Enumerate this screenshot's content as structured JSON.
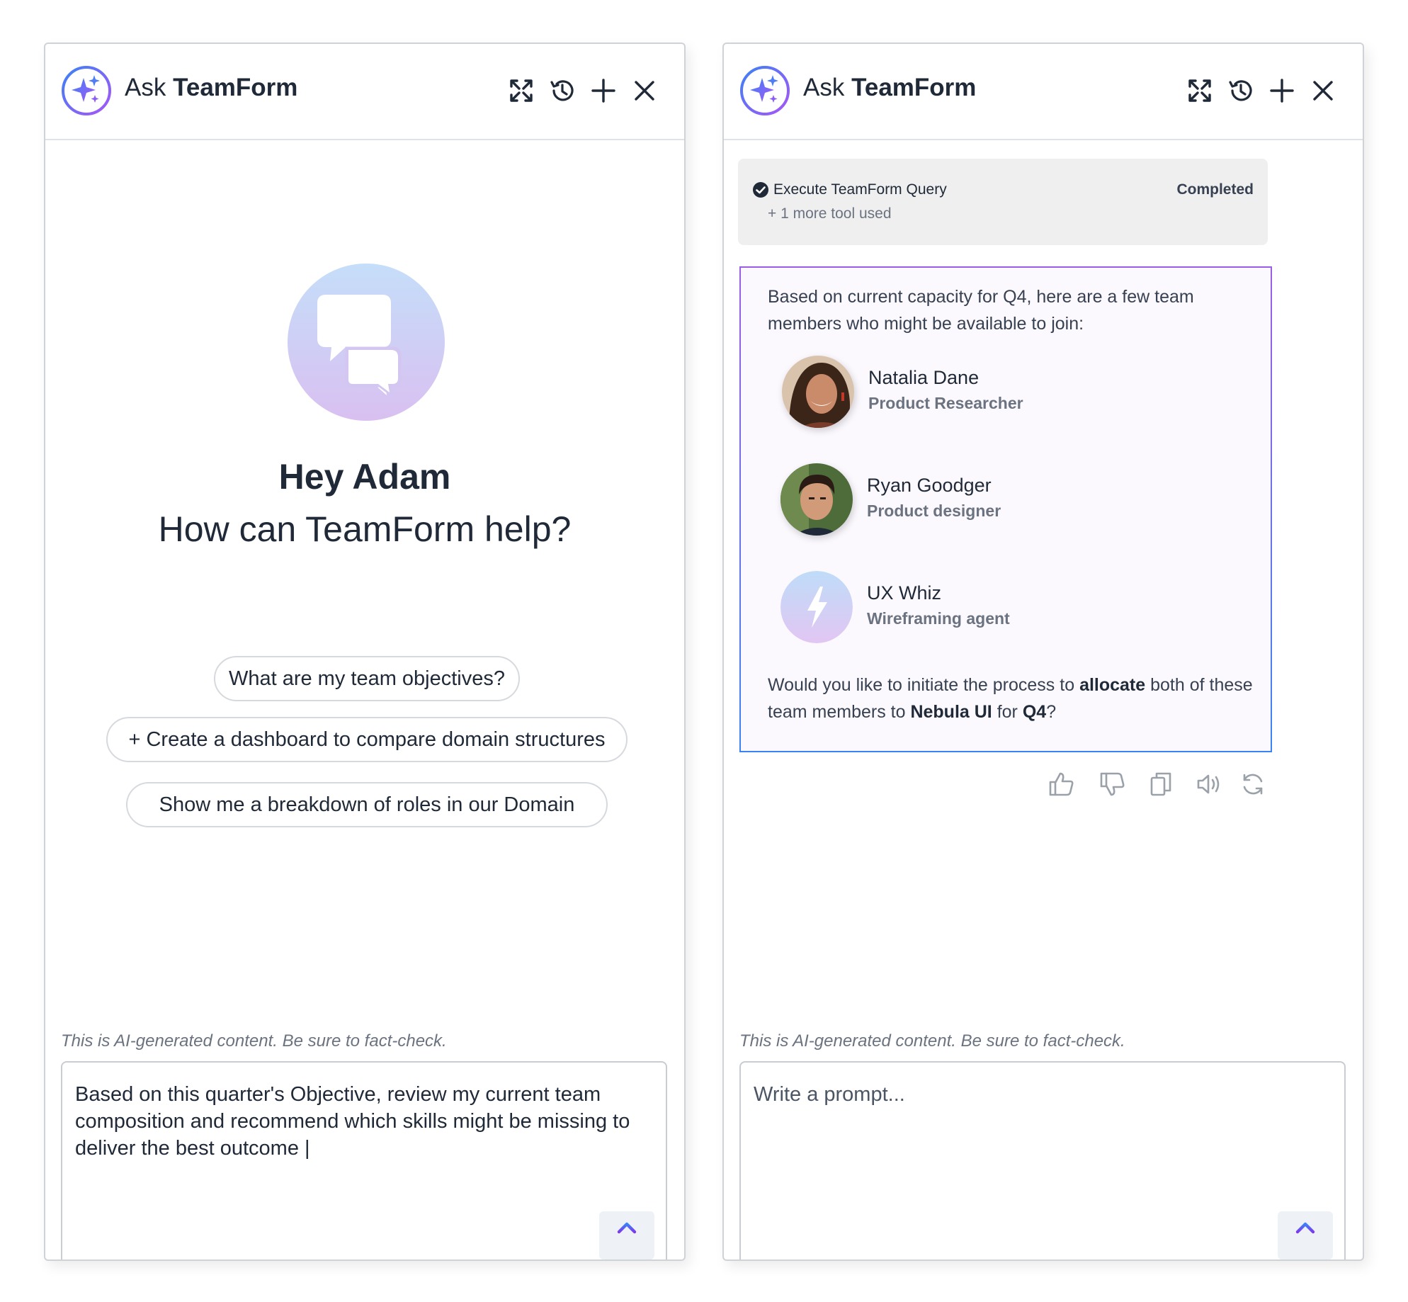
{
  "left_panel": {
    "header": {
      "title_prefix": "Ask",
      "title_brand": "TeamForm"
    },
    "greeting": {
      "name": "Hey Adam",
      "subtitle": "How can TeamForm help?"
    },
    "suggestions": [
      "What are my team objectives?",
      "+ Create a dashboard to compare domain structures",
      "Show me a breakdown of roles in our Domain"
    ],
    "disclaimer": "This is AI-generated content. Be sure to fact-check.",
    "prompt": {
      "value": "Based on this quarter's Objective, review my current team composition and recommend which skills might be missing to deliver the best outcome |"
    }
  },
  "right_panel": {
    "header": {
      "title_prefix": "Ask",
      "title_brand": "TeamForm"
    },
    "tool": {
      "name": "Execute TeamForm Query",
      "more": "+ 1 more tool used",
      "status": "Completed"
    },
    "response": {
      "intro": "Based on current capacity for Q4, here are a few team members who might be available to join:",
      "members": [
        {
          "name": "Natalia Dane",
          "role": "Product Researcher"
        },
        {
          "name": "Ryan Goodger",
          "role": "Product designer"
        },
        {
          "name": "UX Whiz",
          "role": "Wireframing agent"
        }
      ],
      "outro": {
        "p1": "Would you like to initiate the process to ",
        "b1": "allocate",
        "p2": " both of these team members to ",
        "b2": "Nebula UI",
        "p3": " for ",
        "b3": "Q4",
        "p4": "?"
      }
    },
    "disclaimer": "This is AI-generated content. Be sure to fact-check.",
    "prompt": {
      "placeholder": "Write a prompt..."
    }
  },
  "icons": {
    "logo": "sparkle-logo-icon",
    "header_actions": [
      "expand-icon",
      "history-icon",
      "plus-icon",
      "close-icon"
    ],
    "feedback": [
      "thumbs-up-icon",
      "thumbs-down-icon",
      "copy-icon",
      "speaker-icon",
      "refresh-icon"
    ],
    "send": "arrow-up-icon"
  },
  "colors": {
    "accent_blue": "#3b82f6",
    "accent_purple": "#9b5de5",
    "text": "#1f2937",
    "muted": "#6b7280"
  }
}
